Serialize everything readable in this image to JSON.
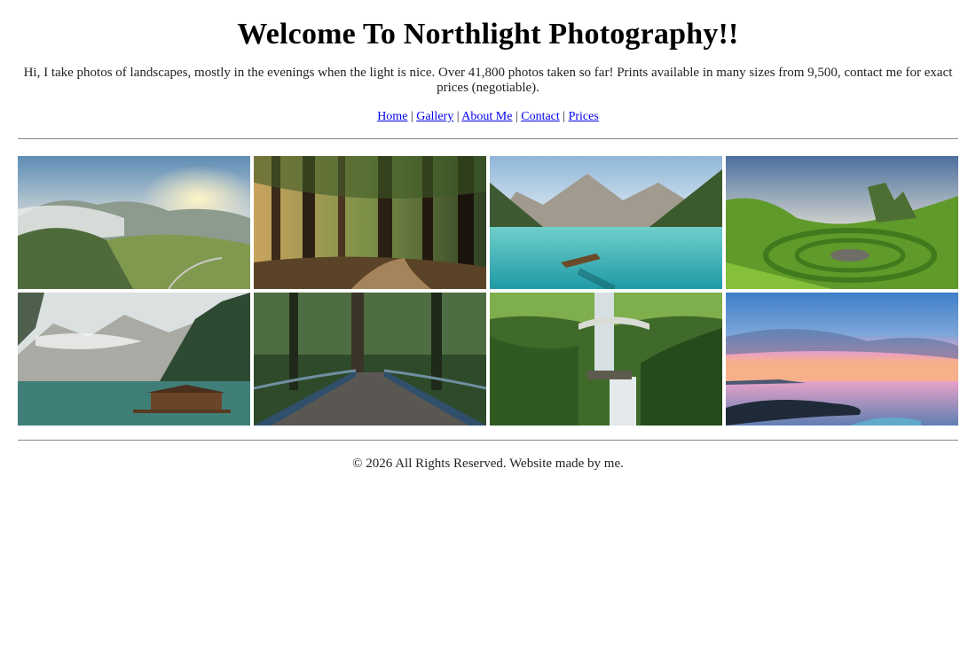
{
  "header": {
    "title": "Welcome To Northlight Photography!!",
    "intro": "Hi, I take photos of landscapes, mostly in the evenings when the light is nice. Over 41,800 photos taken so far! Prints available in many sizes from 9,500, contact me for exact prices (negotiable)."
  },
  "nav": {
    "items": [
      {
        "label": "Home"
      },
      {
        "label": "Gallery"
      },
      {
        "label": "About Me"
      },
      {
        "label": "Contact"
      },
      {
        "label": "Prices"
      }
    ],
    "separator": "|"
  },
  "gallery": {
    "photos": [
      {
        "subject": "misty mountain valley at sunset"
      },
      {
        "subject": "sunlit forest path"
      },
      {
        "subject": "turquoise alpine lake with rowboat"
      },
      {
        "subject": "green hills spiral at sunset"
      },
      {
        "subject": "lake boathouse under cloudy mountains"
      },
      {
        "subject": "bridge into dense forest"
      },
      {
        "subject": "waterfall with stone footbridge"
      },
      {
        "subject": "pink and blue sunset over rocky shore"
      }
    ]
  },
  "footer": {
    "text": "© 2026 All Rights Reserved. Website made by me."
  },
  "colors": {
    "link": "#0000ee",
    "rule": "#888888"
  }
}
